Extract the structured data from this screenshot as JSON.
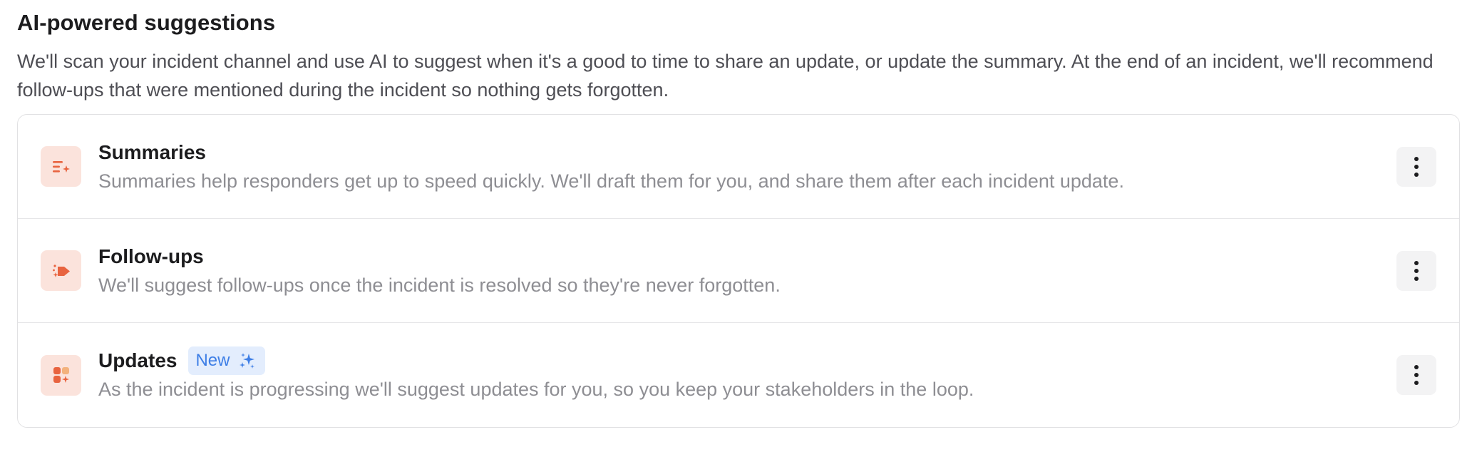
{
  "section": {
    "title": "AI-powered suggestions",
    "description": "We'll scan your incident channel and use AI to suggest when it's a good to time to share an update, or update the summary. At the end of an incident, we'll recommend follow-ups that were mentioned during the incident so nothing gets forgotten."
  },
  "features": [
    {
      "title": "Summaries",
      "description": "Summaries help responders get up to speed quickly. We'll draft them for you, and share them after each incident update.",
      "icon": "summary-lines-sparkle-icon",
      "menu_icon": "more-vertical-icon"
    },
    {
      "title": "Follow-ups",
      "description": "We'll suggest follow-ups once the incident is resolved so they're never forgotten.",
      "icon": "follow-up-arrow-sparkle-icon",
      "menu_icon": "more-vertical-icon"
    },
    {
      "title": "Updates",
      "badge": "New",
      "badge_icon": "sparkles-icon",
      "description": "As the incident is progressing we'll suggest updates for you, so you keep your stakeholders in the loop.",
      "icon": "updates-blocks-sparkle-icon",
      "menu_icon": "more-vertical-icon"
    }
  ],
  "colors": {
    "icon_background": "#fbe3dc",
    "icon_foreground": "#e8633f",
    "badge_background": "#e3edfd",
    "badge_text": "#3d7ee6",
    "border": "#e1e1e3"
  }
}
